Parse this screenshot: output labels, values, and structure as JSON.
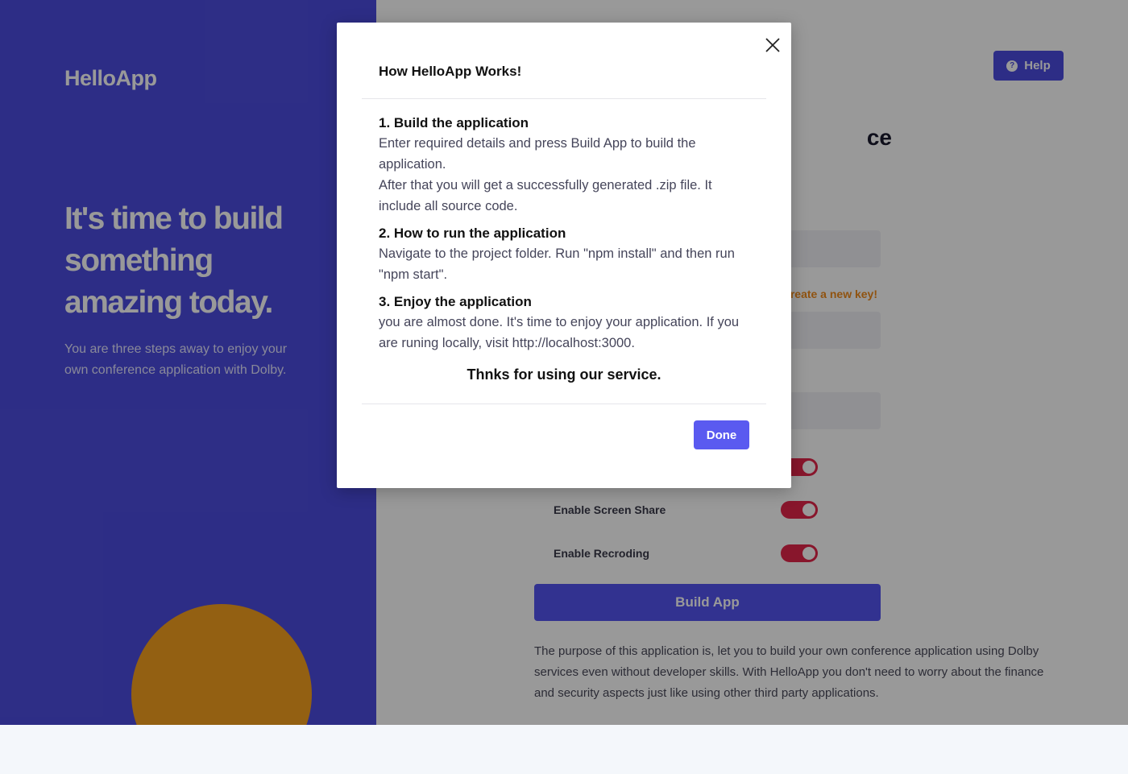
{
  "app": {
    "brand": "HelloApp"
  },
  "hero": {
    "headline": "It's time to build something amazing today.",
    "subtext": "You are three steps away to enjoy your own conference application with Dolby."
  },
  "header": {
    "help_label": "Help"
  },
  "form": {
    "title_visible_fragment": "ce",
    "create_key_fragment": "reate a new key!",
    "toggles": [
      {
        "label": "Enable Screen Share",
        "on": true
      },
      {
        "label": "Enable Recroding",
        "on": true
      }
    ],
    "build_label": "Build App",
    "purpose": "The purpose of this application is, let you to build your own conference application using Dolby services even without developer skills. With HelloApp you don't need to worry about the finance and security aspects just like using other third party applications."
  },
  "modal": {
    "title": "How HelloApp Works!",
    "steps": [
      {
        "title": "1. Build the application",
        "text": "Enter required details and press Build App to build the application.",
        "text2": "After that you will get a successfully generated .zip file. It include all source code."
      },
      {
        "title": "2. How to run the application",
        "text": "Navigate to the project folder. Run \"npm install\" and then run \"npm start\"."
      },
      {
        "title": "3. Enjoy the application",
        "text": "you are almost done. It's time to enjoy your application. If you are runing locally, visit http://localhost:3000."
      }
    ],
    "thanks": "Thnks for using our service.",
    "done_label": "Done"
  },
  "colors": {
    "primary": "#4c4ce0",
    "accent_orange": "#f5a01f",
    "toggle_on": "#e3254a",
    "done_button": "#5a5af0"
  }
}
